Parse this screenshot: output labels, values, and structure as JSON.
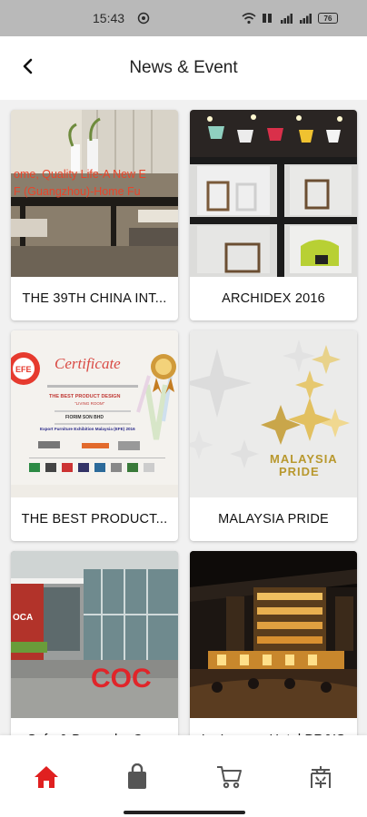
{
  "status_bar": {
    "time": "15:43",
    "battery": "76"
  },
  "header": {
    "title": "News & Event"
  },
  "cards": [
    {
      "label": "THE 39TH CHINA INT...",
      "image_overlay": {
        "line1": "ome, Quality Life-A New E",
        "line2": "F (Guangzhou)-Home Fu"
      }
    },
    {
      "label": "ARCHIDEX 2016"
    },
    {
      "label": "THE BEST PRODUCT...",
      "certificate": {
        "heading": "Certificate",
        "award": "THE BEST PRODUCT DESIGN",
        "award_sub": "\"LIVING ROOM\"",
        "company": "FIORIM SON BHD",
        "event": "Export Furniture Exhibition Malaysia (EFE) 2016",
        "logo_text": "EFE"
      }
    },
    {
      "label": "MALAYSIA PRIDE",
      "logo": {
        "line1": "MALAYSIA",
        "line2": "PRIDE"
      }
    },
    {
      "label": "Sofa & Beyond – Co...",
      "sign_text": "COC"
    },
    {
      "label": "Le Lounge Hotel PR&IS"
    }
  ],
  "colors": {
    "accent": "#e02020",
    "nav_icon": "#555555"
  },
  "nav": [
    {
      "name": "home",
      "icon": "home-icon",
      "active": true
    },
    {
      "name": "shop",
      "icon": "shopping-bag-icon"
    },
    {
      "name": "cart",
      "icon": "cart-icon"
    },
    {
      "name": "store",
      "icon": "store-icon"
    }
  ]
}
